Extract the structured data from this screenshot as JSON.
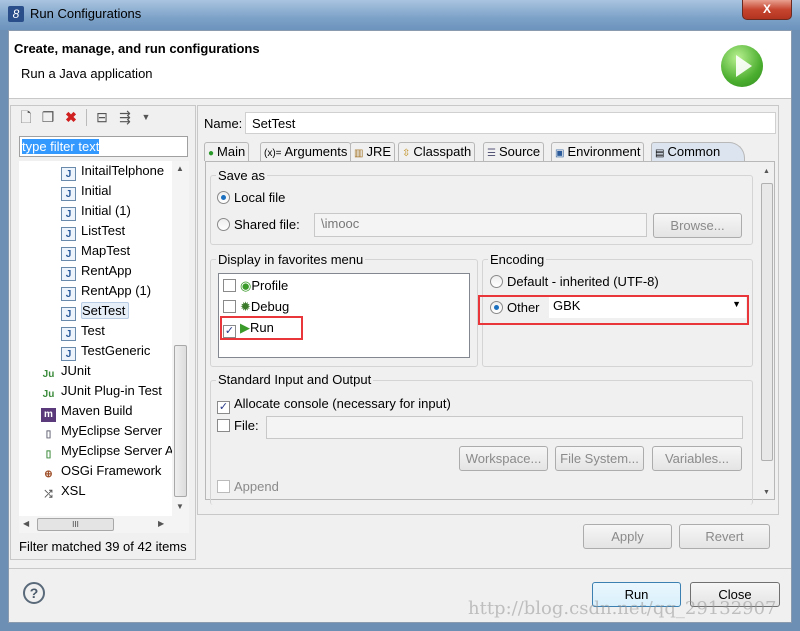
{
  "window": {
    "title": "Run Configurations",
    "close_label": "X"
  },
  "header": {
    "title": "Create, manage, and run configurations",
    "subtitle": "Run a Java application",
    "icon": "run-icon"
  },
  "left": {
    "toolbar": [
      "new-config-icon",
      "duplicate-icon",
      "delete-icon",
      "collapse-all-icon",
      "filter-icon",
      "dropdown-icon"
    ],
    "filter_placeholder": "type filter text",
    "tree": [
      {
        "label": "InitailTelphone",
        "icon": "java-app-icon",
        "level": 2
      },
      {
        "label": "Initial",
        "icon": "java-app-icon",
        "level": 2
      },
      {
        "label": "Initial (1)",
        "icon": "java-app-icon",
        "level": 2
      },
      {
        "label": "ListTest",
        "icon": "java-app-icon",
        "level": 2
      },
      {
        "label": "MapTest",
        "icon": "java-app-icon",
        "level": 2
      },
      {
        "label": "RentApp",
        "icon": "java-app-icon",
        "level": 2
      },
      {
        "label": "RentApp (1)",
        "icon": "java-app-icon",
        "level": 2
      },
      {
        "label": "SetTest",
        "icon": "java-app-icon",
        "level": 2,
        "selected": true
      },
      {
        "label": "Test",
        "icon": "java-app-icon",
        "level": 2
      },
      {
        "label": "TestGeneric",
        "icon": "java-app-icon",
        "level": 2
      },
      {
        "label": "JUnit",
        "icon": "junit-icon",
        "level": 1
      },
      {
        "label": "JUnit Plug-in Test",
        "icon": "junit-plugin-icon",
        "level": 1
      },
      {
        "label": "Maven Build",
        "icon": "maven-icon",
        "level": 1
      },
      {
        "label": "MyEclipse Server",
        "icon": "server-icon",
        "level": 1
      },
      {
        "label": "MyEclipse Server A",
        "icon": "server-app-icon",
        "level": 1
      },
      {
        "label": "OSGi Framework",
        "icon": "osgi-icon",
        "level": 1
      },
      {
        "label": "XSL",
        "icon": "xsl-icon",
        "level": 1
      }
    ],
    "hscroll_label": "III",
    "filter_message": "Filter matched 39 of 42 items"
  },
  "right": {
    "name_label": "Name:",
    "name_value": "SetTest",
    "tabs": [
      {
        "label": "Main"
      },
      {
        "label": "Arguments"
      },
      {
        "label": "JRE"
      },
      {
        "label": "Classpath"
      },
      {
        "label": "Source"
      },
      {
        "label": "Environment"
      },
      {
        "label": "Common",
        "active": true
      }
    ],
    "save_as": {
      "legend": "Save as",
      "local_label": "Local file",
      "shared_label": "Shared file:",
      "shared_value": "\\imooc",
      "browse": "Browse...",
      "selected": "local"
    },
    "favorites": {
      "legend": "Display in favorites menu",
      "items": [
        {
          "label": "Profile",
          "checked": false
        },
        {
          "label": "Debug",
          "checked": false
        },
        {
          "label": "Run",
          "checked": true
        }
      ]
    },
    "encoding": {
      "legend": "Encoding",
      "default_label": "Default - inherited (UTF-8)",
      "other_label": "Other",
      "other_value": "GBK",
      "selected": "other"
    },
    "stdio": {
      "legend": "Standard Input and Output",
      "allocate_label": "Allocate console (necessary for input)",
      "allocate_checked": true,
      "file_label": "File:",
      "file_checked": false,
      "workspace": "Workspace...",
      "filesystem": "File System...",
      "variables": "Variables...",
      "append_label": "Append",
      "append_checked": false
    },
    "apply": "Apply",
    "revert": "Revert"
  },
  "footer": {
    "help": "?",
    "run": "Run",
    "close": "Close"
  },
  "watermark": "http://blog.csdn.net/qq_29132907",
  "colors": {
    "highlight_box": "#e8363a",
    "selection": "#3399ff"
  }
}
